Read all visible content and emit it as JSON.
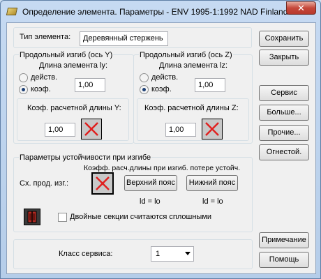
{
  "window": {
    "title": "Определение элемента. Параметры - ENV 1995-1:1992 NAD Finland",
    "close_symbol": "✕"
  },
  "element_type": {
    "label": "Тип элемента:",
    "value": "Деревянный стержень"
  },
  "buckling_y": {
    "title": "Продольный изгиб (ось Y)",
    "length_label": "Длина элемента ly:",
    "option_actual": "действ.",
    "option_coef": "коэф.",
    "selected": "coef",
    "length_value": "1,00",
    "coef_label": "Коэф. расчетной длины Y:",
    "coef_value": "1,00"
  },
  "buckling_z": {
    "title": "Продольный изгиб (ось Z)",
    "length_label": "Длина элемента lz:",
    "option_actual": "действ.",
    "option_coef": "коэф.",
    "selected": "coef",
    "length_value": "1,00",
    "coef_label": "Коэф. расчетной длины Z:",
    "coef_value": "1,00"
  },
  "stability": {
    "title": "Параметры устойчивости при изгибе",
    "coef_caption": "Коэфф. расч.длины при изгиб. потере устойч.",
    "scheme_label": "Сх. прод. изг.:",
    "upper_flange": "Верхний пояс",
    "lower_flange": "Нижний пояс",
    "upper_formula": "ld = lo",
    "lower_formula": "ld = lo",
    "double_sections_label": "Двойные секции считаются сплошными",
    "double_sections_checked": false
  },
  "service": {
    "label": "Класс сервиса:",
    "value": "1"
  },
  "buttons": {
    "save": "Сохранить",
    "close": "Закрыть",
    "service": "Сервис",
    "more": "Больше...",
    "other": "Прочие...",
    "fire": "Огнестой.",
    "note": "Примечание",
    "help": "Помощь"
  },
  "colors": {
    "cross_red": "#e0201f",
    "titlebar": "#c6daf2"
  }
}
